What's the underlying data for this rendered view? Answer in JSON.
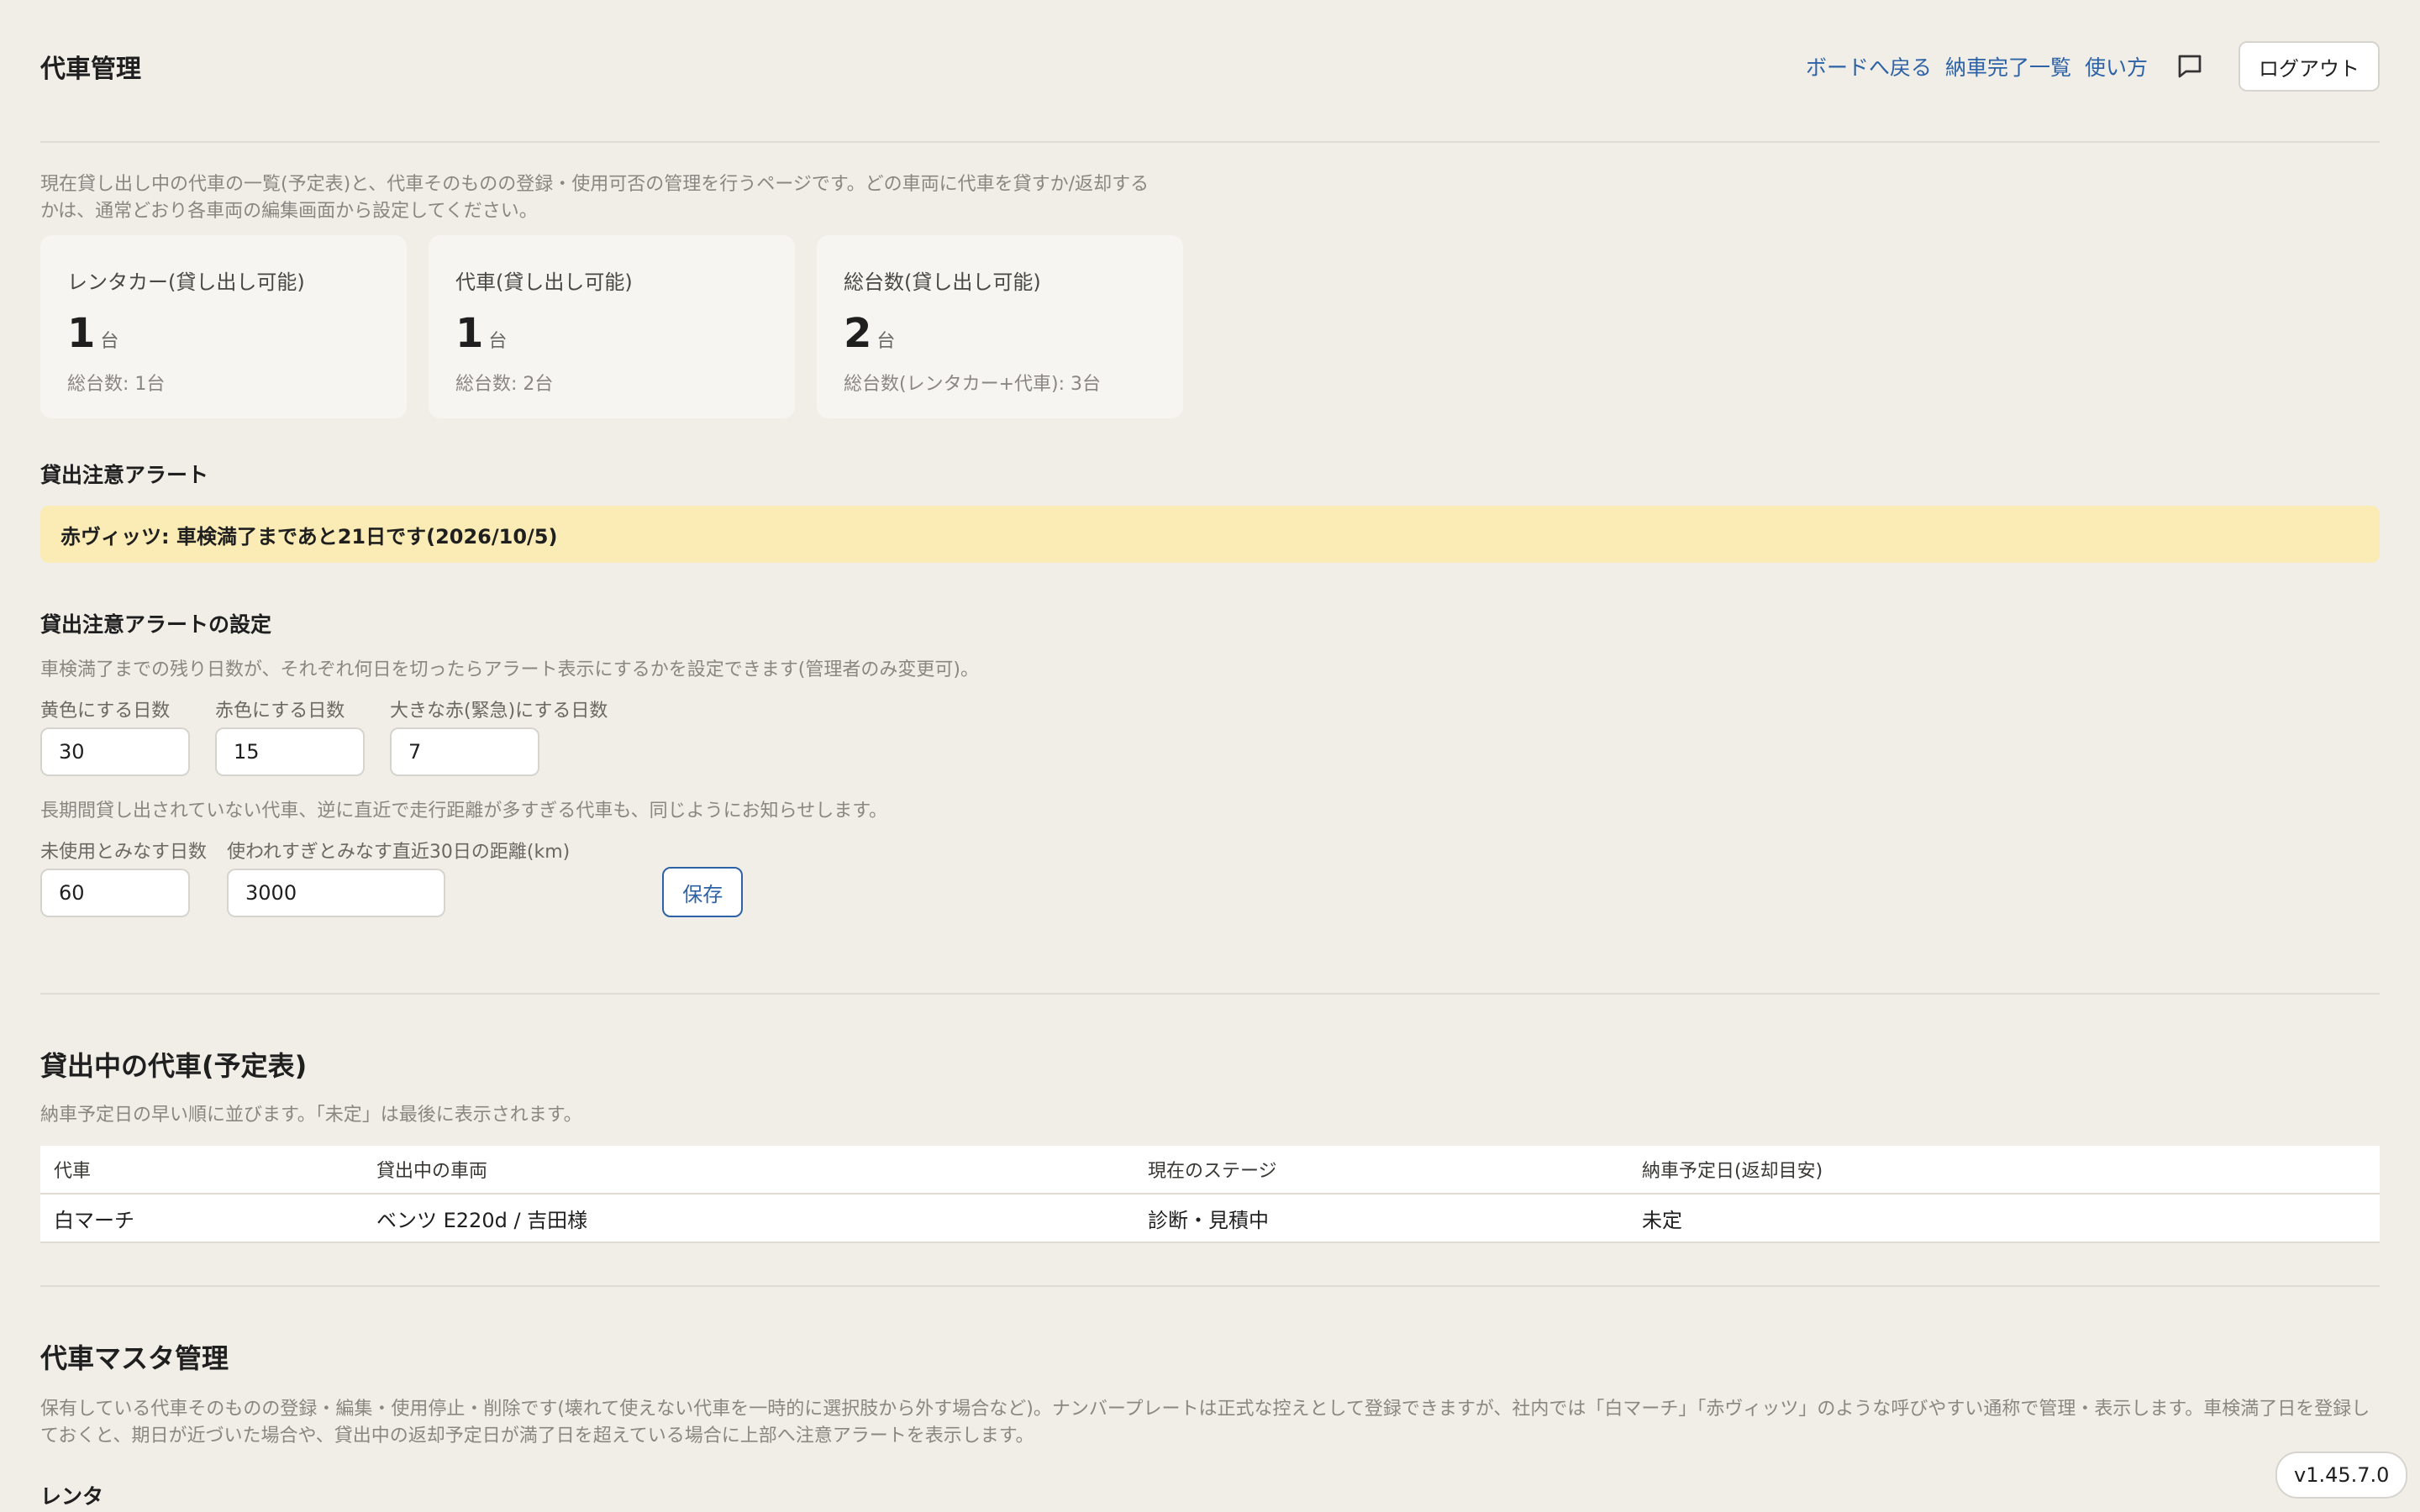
{
  "header": {
    "title": "代車管理",
    "nav": [
      "ボードへ戻る",
      "納車完了一覧",
      "使い方"
    ],
    "chat_icon": "chat-bubble-icon",
    "logout": "ログアウト"
  },
  "intro": "現在貸し出し中の代車の一覧(予定表)と、代車そのものの登録・使用可否の管理を行うページです。どの車両に代車を貸すか/返却するかは、通常どおり各車両の編集画面から設定してください。",
  "cards": [
    {
      "label": "レンタカー(貸し出し可能)",
      "value": "1",
      "unit": "台",
      "total": "総台数: 1台"
    },
    {
      "label": "代車(貸し出し可能)",
      "value": "1",
      "unit": "台",
      "total": "総台数: 2台"
    },
    {
      "label": "総台数(貸し出し可能)",
      "value": "2",
      "unit": "台",
      "total": "総台数(レンタカー+代車): 3台"
    }
  ],
  "alert": {
    "title": "貸出注意アラート",
    "message": "赤ヴィッツ: 車検満了まであと21日です(2026/10/5)",
    "color": "#fbecb5"
  },
  "settings": {
    "title": "貸出注意アラートの設定",
    "desc1": "車検満了までの残り日数が、それぞれ何日を切ったらアラート表示にするかを設定できます(管理者のみ変更可)。",
    "yellow_label": "黄色にする日数",
    "yellow_value": "30",
    "red_label": "赤色にする日数",
    "red_value": "15",
    "urgent_label": "大きな赤(緊急)にする日数",
    "urgent_value": "7",
    "desc2": "長期間貸し出されていない代車、逆に直近で走行距離が多すぎる代車も、同じようにお知らせします。",
    "unused_label": "未使用とみなす日数",
    "unused_value": "60",
    "overuse_label": "使われすぎとみなす直近30日の距離(km)",
    "overuse_value": "3000",
    "save": "保存"
  },
  "schedule": {
    "title": "貸出中の代車(予定表)",
    "desc": "納車予定日の早い順に並びます。「未定」は最後に表示されます。",
    "columns": [
      "代車",
      "貸出中の車両",
      "現在のステージ",
      "納車予定日(返却目安)"
    ],
    "rows": [
      [
        "白マーチ",
        "ベンツ E220d / 吉田様",
        "診断・見積中",
        "未定"
      ]
    ]
  },
  "master": {
    "title": "代車マスタ管理",
    "desc": "保有している代車そのものの登録・編集・使用停止・削除です(壊れて使えない代車を一時的に選択肢から外す場合など)。ナンバープレートは正式な控えとして登録できますが、社内では「白マーチ」「赤ヴィッツ」のような呼びやすい通称で管理・表示します。車検満了日を登録しておくと、期日が近づいた場合や、貸出中の返却予定日が満了日を超えている場合に上部へ注意アラートを表示します。",
    "sub": "レンタ"
  },
  "version": "v1.45.7.0",
  "colors": {
    "accent": "#2e62a6",
    "background": "#f1eee8",
    "alert": "#fbecb5"
  }
}
